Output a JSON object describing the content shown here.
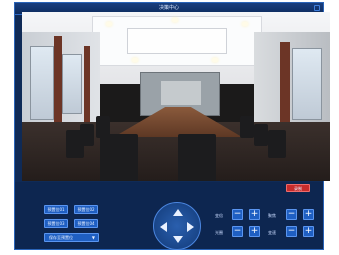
{
  "window": {
    "title": "决策中心"
  },
  "toolbar": {
    "record_label": "录制"
  },
  "presets": {
    "items": [
      "预置位01",
      "预置位02",
      "预置位03",
      "预置位04"
    ],
    "dropdown_label": "保存至预置位"
  },
  "ptz_controls": {
    "zoom_label": "变倍",
    "focus_label": "聚焦",
    "aperture_label": "光圈",
    "speed_label": "变速"
  },
  "icons": [
    "close-icon",
    "arrow-up-icon",
    "arrow-down-icon",
    "arrow-left-icon",
    "arrow-right-icon",
    "minus-icon",
    "plus-icon",
    "chevron-down-icon"
  ],
  "colors": {
    "panel_bg": "#0f2a56",
    "accent": "#1f5fc2",
    "record": "#c62c2c"
  }
}
